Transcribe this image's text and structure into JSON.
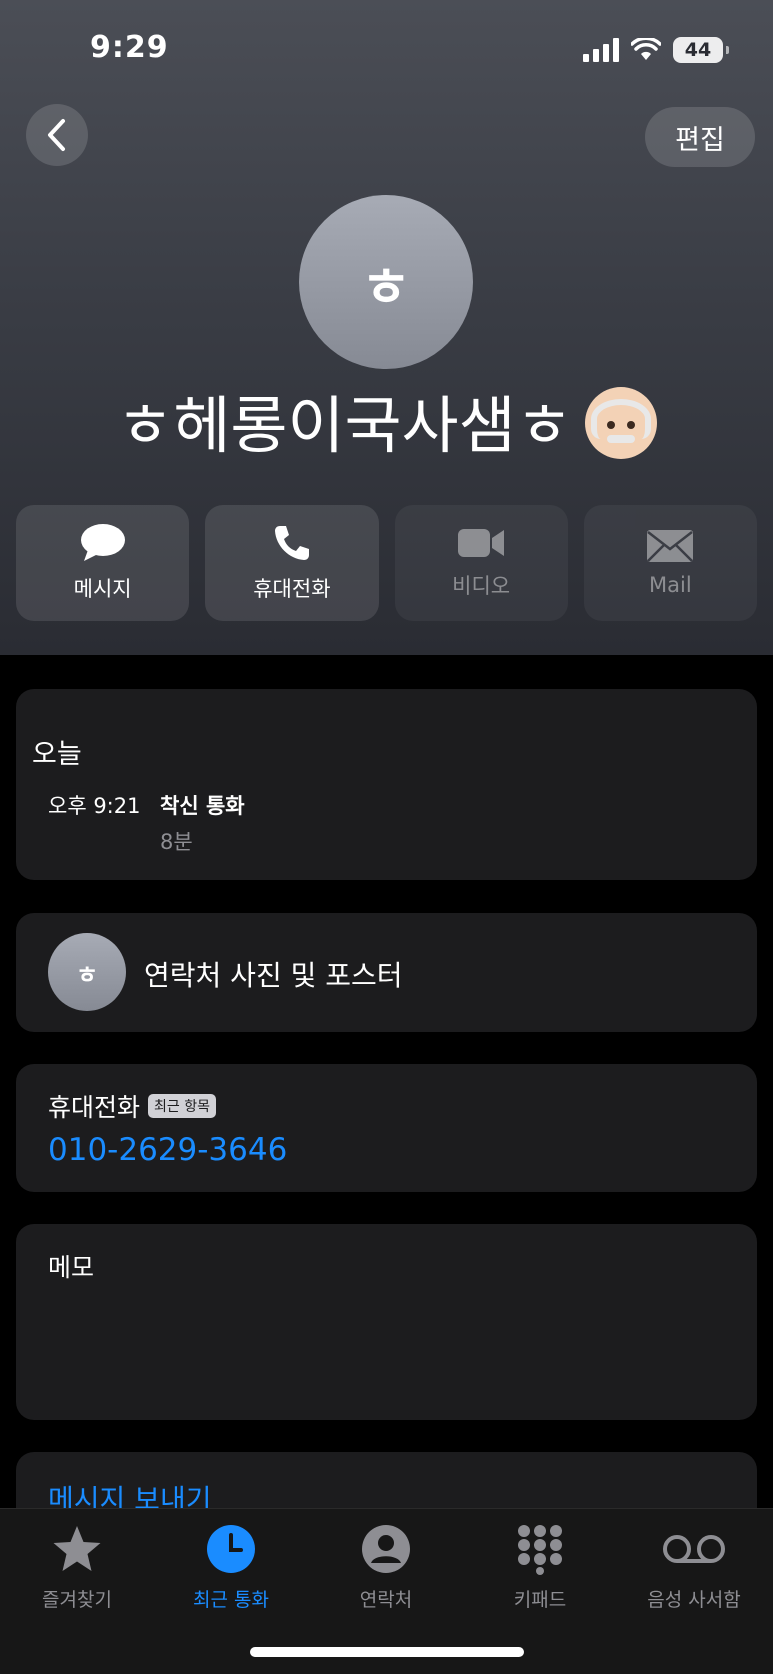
{
  "status": {
    "time": "9:29",
    "battery": "44"
  },
  "nav": {
    "edit_label": "편집"
  },
  "contact": {
    "avatar_initial": "ㅎ",
    "name": "ㅎ헤롱이국사샘ㅎ"
  },
  "actions": [
    {
      "label": "메시지",
      "icon": "message-icon",
      "enabled": true
    },
    {
      "label": "휴대전화",
      "icon": "phone-icon",
      "enabled": true
    },
    {
      "label": "비디오",
      "icon": "video-icon",
      "enabled": false
    },
    {
      "label": "Mail",
      "icon": "mail-icon",
      "enabled": false
    }
  ],
  "recent": {
    "title": "오늘",
    "time": "오후 9:21",
    "type": "착신 통화",
    "duration": "8분"
  },
  "poster": {
    "initial": "ㅎ",
    "label": "연락처 사진 및 포스터"
  },
  "phone": {
    "label": "휴대전화",
    "badge": "최근 항목",
    "number": "010-2629-3646"
  },
  "memo": {
    "label": "메모"
  },
  "send_message": {
    "label": "메시지 보내기"
  },
  "tabs": [
    {
      "label": "즐겨찾기",
      "icon": "star-icon",
      "active": false
    },
    {
      "label": "최근 통화",
      "icon": "clock-icon",
      "active": true
    },
    {
      "label": "연락처",
      "icon": "person-icon",
      "active": false
    },
    {
      "label": "키패드",
      "icon": "keypad-icon",
      "active": false
    },
    {
      "label": "음성 사서함",
      "icon": "voicemail-icon",
      "active": false
    }
  ],
  "colors": {
    "accent": "#1a8cff",
    "card": "#1c1c1e",
    "tab_inactive": "#8e8e93"
  }
}
